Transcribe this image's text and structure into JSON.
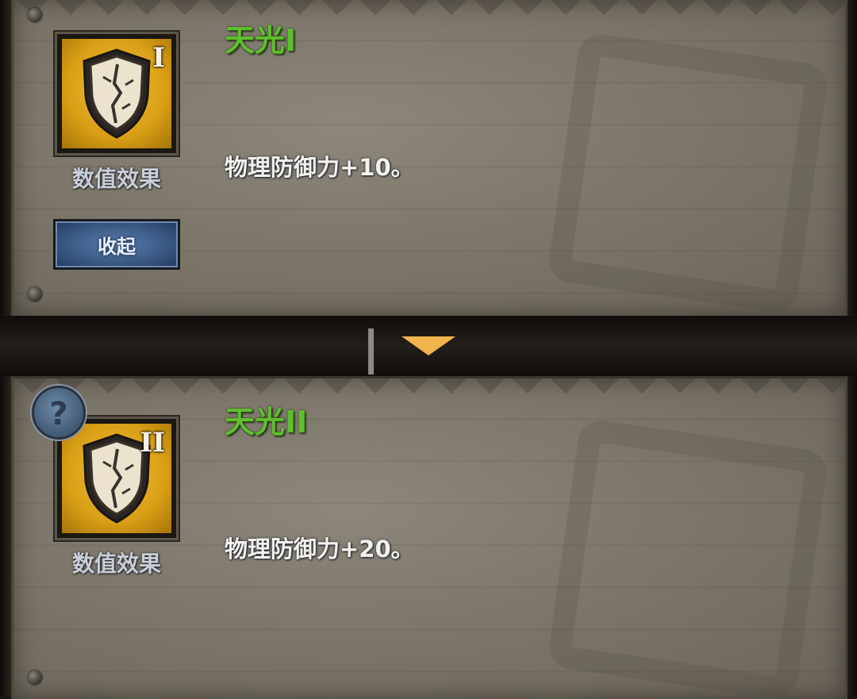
{
  "skills": [
    {
      "title": "天光I",
      "level": "I",
      "icon": "shield-icon",
      "caption": "数值效果",
      "description": "物理防御力+10。",
      "collapse_label": "收起"
    },
    {
      "title": "天光II",
      "level": "II",
      "icon": "shield-icon",
      "caption": "数值效果",
      "description": "物理防御力+20。",
      "help_symbol": "?"
    }
  ],
  "colors": {
    "title": "#5fbf2e",
    "icon_bg": "#d99f16",
    "button": "#34507a",
    "arrow": "#f3b34c"
  }
}
